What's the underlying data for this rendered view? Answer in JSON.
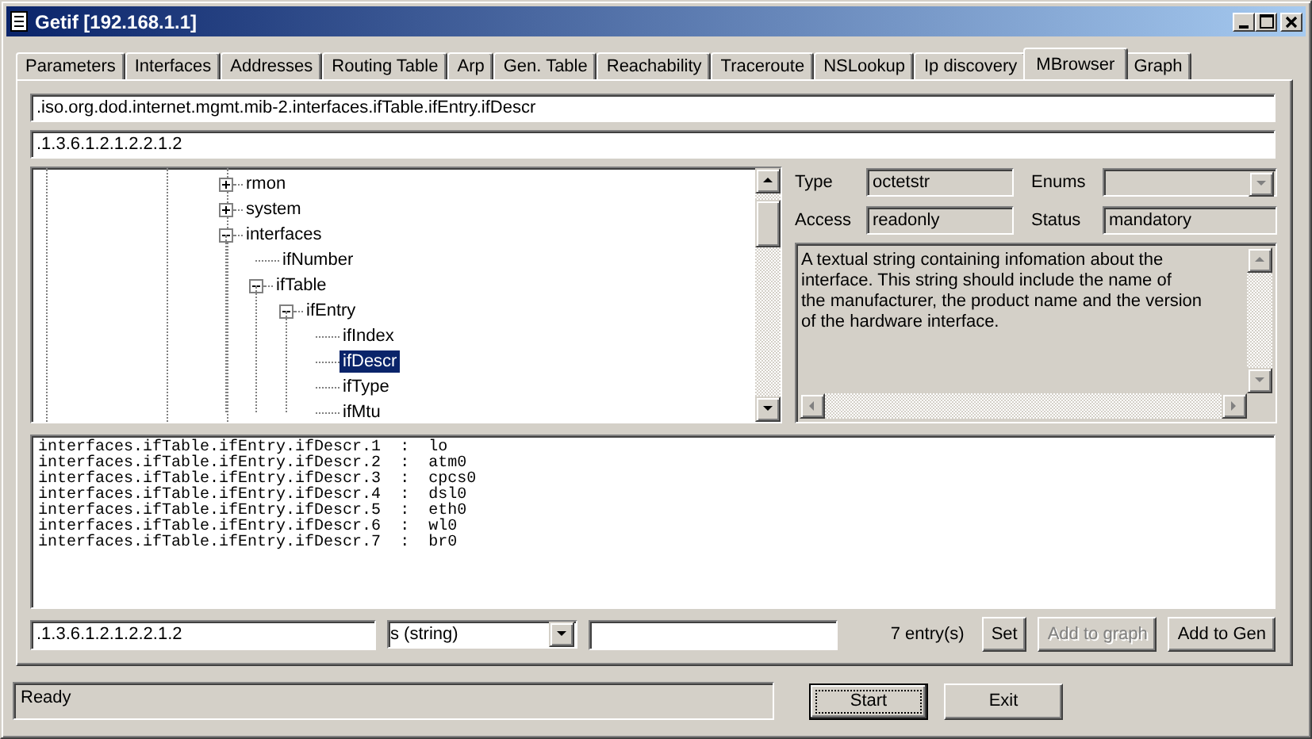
{
  "window": {
    "title": "Getif [192.168.1.1]"
  },
  "tabs": [
    {
      "label": "Parameters",
      "selected": false
    },
    {
      "label": "Interfaces",
      "selected": false
    },
    {
      "label": "Addresses",
      "selected": false
    },
    {
      "label": "Routing Table",
      "selected": false
    },
    {
      "label": "Arp",
      "selected": false
    },
    {
      "label": "Gen. Table",
      "selected": false
    },
    {
      "label": "Reachability",
      "selected": false
    },
    {
      "label": "Traceroute",
      "selected": false
    },
    {
      "label": "NSLookup",
      "selected": false
    },
    {
      "label": "Ip discovery",
      "selected": false
    },
    {
      "label": "MBrowser",
      "selected": true
    },
    {
      "label": "Graph",
      "selected": false
    }
  ],
  "path_field": {
    "value": ".iso.org.dod.internet.mgmt.mib-2.interfaces.ifTable.ifEntry.ifDescr"
  },
  "oid_field": {
    "value": ".1.3.6.1.2.1.2.2.1.2"
  },
  "tree": [
    {
      "label": "rmon",
      "expanded": false,
      "selected": false
    },
    {
      "label": "system",
      "expanded": false,
      "selected": false
    },
    {
      "label": "interfaces",
      "expanded": true,
      "selected": false,
      "children": [
        {
          "label": "ifNumber",
          "selected": false
        },
        {
          "label": "ifTable",
          "expanded": true,
          "selected": false,
          "children": [
            {
              "label": "ifEntry",
              "expanded": true,
              "selected": false,
              "children": [
                {
                  "label": "ifIndex",
                  "selected": false
                },
                {
                  "label": "ifDescr",
                  "selected": true
                },
                {
                  "label": "ifType",
                  "selected": false
                },
                {
                  "label": "ifMtu",
                  "selected": false
                }
              ]
            }
          ]
        }
      ]
    }
  ],
  "details": {
    "type_label": "Type",
    "type_value": "octetstr",
    "enums_label": "Enums",
    "access_label": "Access",
    "access_value": "readonly",
    "status_label": "Status",
    "status_value": "mandatory",
    "description": [
      "A textual string containing infomation about the",
      "interface. This string should include the name of",
      "the manufacturer, the product name and the version",
      "of the hardware interface."
    ]
  },
  "results": [
    {
      "oid": "interfaces.ifTable.ifEntry.ifDescr.1",
      "separator": ":",
      "value": "lo"
    },
    {
      "oid": "interfaces.ifTable.ifEntry.ifDescr.2",
      "separator": ":",
      "value": "atm0"
    },
    {
      "oid": "interfaces.ifTable.ifEntry.ifDescr.3",
      "separator": ":",
      "value": "cpcs0"
    },
    {
      "oid": "interfaces.ifTable.ifEntry.ifDescr.4",
      "separator": ":",
      "value": "dsl0"
    },
    {
      "oid": "interfaces.ifTable.ifEntry.ifDescr.5",
      "separator": ":",
      "value": "eth0"
    },
    {
      "oid": "interfaces.ifTable.ifEntry.ifDescr.6",
      "separator": ":",
      "value": "wl0"
    },
    {
      "oid": "interfaces.ifTable.ifEntry.ifDescr.7",
      "separator": ":",
      "value": "br0"
    }
  ],
  "set_row": {
    "oid_value": ".1.3.6.1.2.1.2.2.1.2",
    "type_value": "s (string)",
    "entry_count": "7 entry(s)",
    "buttons": [
      {
        "label": "Set",
        "disabled": false
      },
      {
        "label": "Add to graph",
        "disabled": true
      },
      {
        "label": "Add to Gen",
        "disabled": false
      }
    ]
  },
  "status_bar": {
    "text": "Ready"
  },
  "buttons": [
    {
      "label": "Start",
      "focused": true
    },
    {
      "label": "Exit",
      "focused": false
    }
  ]
}
